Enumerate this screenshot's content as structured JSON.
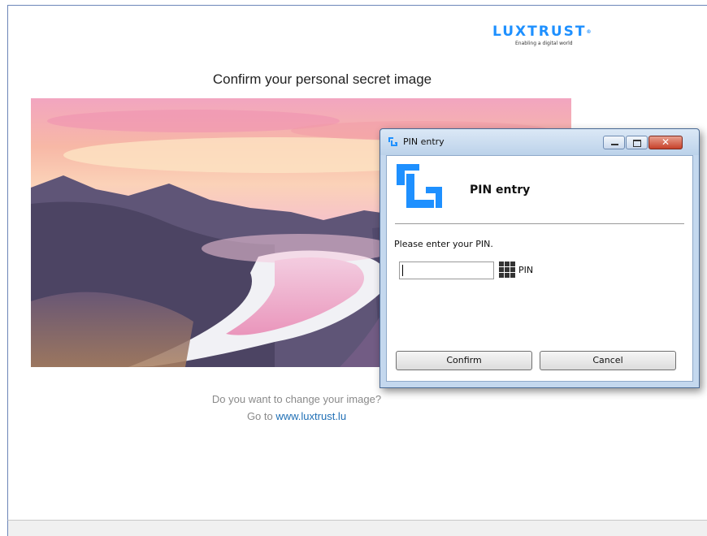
{
  "brand": {
    "name": "LUXTRUST",
    "trademark": "®",
    "tagline": "Enabling a digital world",
    "color": "#1e90ff"
  },
  "page": {
    "title": "Confirm your personal secret image",
    "change_question": "Do you want to change your image?",
    "goto_prefix": "Go to",
    "goto_link": "www.luxtrust.lu"
  },
  "dialog": {
    "window_title": "PIN entry",
    "heading": "PIN entry",
    "prompt": "Please enter your PIN.",
    "pin_value": "",
    "pin_label": "PIN",
    "confirm_label": "Confirm",
    "cancel_label": "Cancel",
    "close_glyph": "✕"
  },
  "icons": {
    "brand_logo": "luxtrust-logo",
    "dialog_logo": "luxtrust-bracket-icon",
    "keypad": "keypad-icon"
  }
}
